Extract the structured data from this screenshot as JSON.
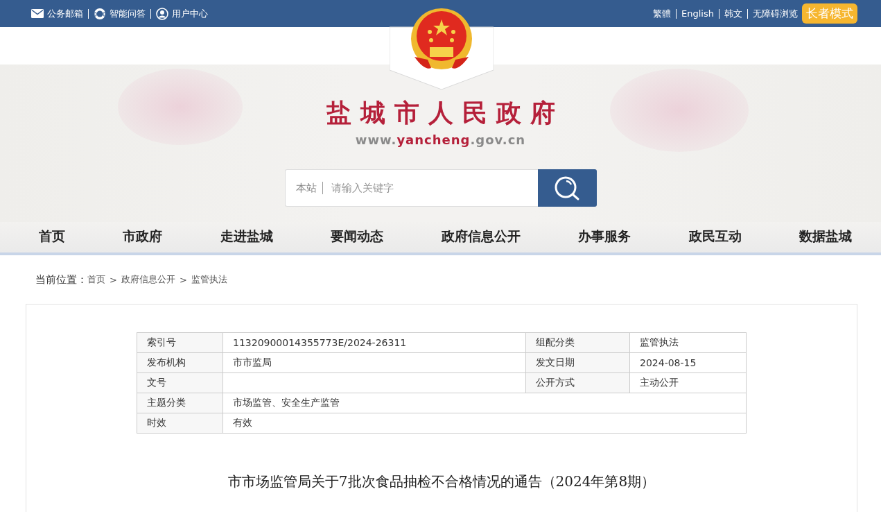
{
  "top_bar": {
    "left_links": [
      "公务邮箱",
      "智能问答",
      "用户中心"
    ],
    "right_links": [
      "繁體",
      "English",
      "韩文",
      "无障碍浏览"
    ],
    "elder_mode_button": "长者模式"
  },
  "header": {
    "site_title": "盐城市人民政府",
    "url_prefix": "www.",
    "url_highlight": "yancheng",
    "url_suffix": ".gov.cn"
  },
  "search": {
    "scope": "本站",
    "placeholder": "请输入关键字"
  },
  "nav": [
    "首页",
    "市政府",
    "走进盐城",
    "要闻动态",
    "政府信息公开",
    "办事服务",
    "政民互动",
    "数据盐城"
  ],
  "breadcrumb": {
    "label": "当前位置：",
    "separator": ">",
    "items": [
      "首页",
      "政府信息公开",
      "监管执法"
    ]
  },
  "meta_table": {
    "rows": [
      [
        {
          "label": "索引号",
          "value": "11320900014355773E/2024-26311"
        },
        {
          "label": "组配分类",
          "value": "监管执法"
        }
      ],
      [
        {
          "label": "发布机构",
          "value": "市市监局"
        },
        {
          "label": "发文日期",
          "value": "2024-08-15"
        }
      ],
      [
        {
          "label": "文号"
        },
        {
          "label": "公开方式",
          "value": "主动公开"
        }
      ],
      [
        {
          "label": "主题分类",
          "value": "市场监管、安全生产监管"
        }
      ],
      [
        {
          "label": "时效",
          "value": "有效"
        }
      ]
    ]
  },
  "article_title": "市市场监管局关于7批次食品抽检不合格情况的通告（2024年第8期）"
}
